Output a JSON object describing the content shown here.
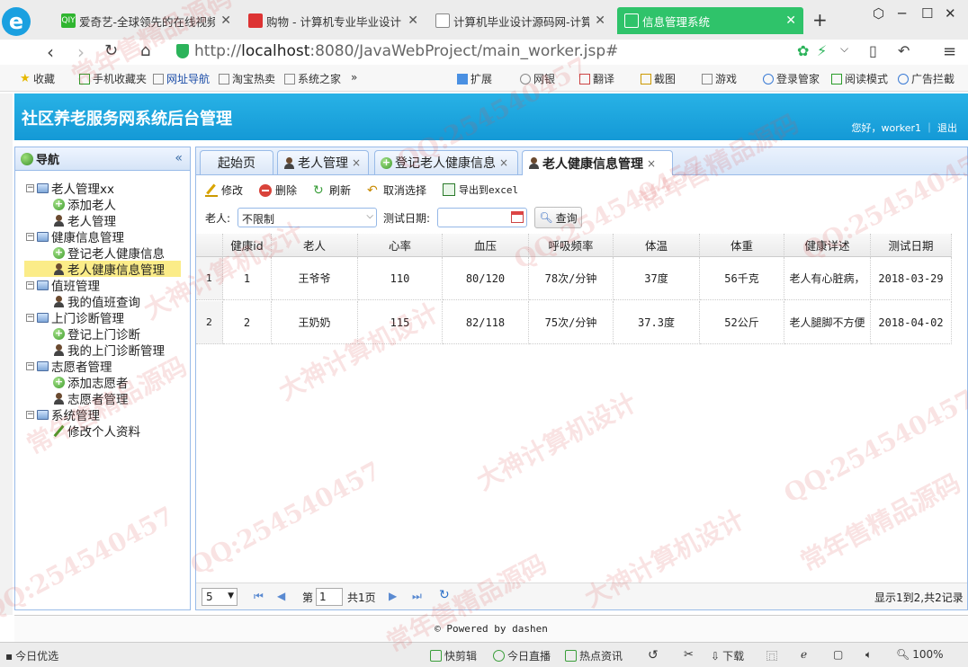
{
  "browser": {
    "tabs": [
      {
        "label": "爱奇艺-全球领先的在线视频",
        "fav": "QIY",
        "fav_color": "#2fb52f"
      },
      {
        "label": "购物 - 计算机专业毕业设计",
        "fav": "",
        "fav_color": "#d33"
      },
      {
        "label": "计算机毕业设计源码网-计算",
        "fav": "",
        "fav_color": "#ffffff"
      },
      {
        "label": "信息管理系统",
        "fav": "",
        "fav_color": "#ffffff"
      }
    ],
    "new_tab": "+",
    "url_prefix": "http://",
    "url_host": "localhost",
    "url_rest": ":8080/JavaWebProject/main_worker.jsp#",
    "bookmarks": [
      "收藏",
      "手机收藏夹",
      "网址导航",
      "淘宝热卖",
      "系统之家",
      "扩展",
      "网银",
      "翻译",
      "截图",
      "游戏",
      "登录管家",
      "阅读模式",
      "广告拦截"
    ],
    "bookmarks_more": "»"
  },
  "app": {
    "title": "社区养老服务网系统后台管理",
    "user_greeting": "您好，worker1 ｜ 退出",
    "footer": "© Powered by dashen"
  },
  "nav": {
    "title": "导航",
    "collapse": "«",
    "items": [
      {
        "label": "老人管理xx",
        "level": 0
      },
      {
        "label": "添加老人",
        "level": 1,
        "icon": "add"
      },
      {
        "label": "老人管理",
        "level": 1,
        "icon": "user"
      },
      {
        "label": "健康信息管理",
        "level": 0
      },
      {
        "label": "登记老人健康信息",
        "level": 1,
        "icon": "add"
      },
      {
        "label": "老人健康信息管理",
        "level": 1,
        "icon": "user",
        "selected": true
      },
      {
        "label": "值班管理",
        "level": 0
      },
      {
        "label": "我的值班查询",
        "level": 1,
        "icon": "user"
      },
      {
        "label": "上门诊断管理",
        "level": 0
      },
      {
        "label": "登记上门诊断",
        "level": 1,
        "icon": "add"
      },
      {
        "label": "我的上门诊断管理",
        "level": 1,
        "icon": "user"
      },
      {
        "label": "志愿者管理",
        "level": 0
      },
      {
        "label": "添加志愿者",
        "level": 1,
        "icon": "add"
      },
      {
        "label": "志愿者管理",
        "level": 1,
        "icon": "user"
      },
      {
        "label": "系统管理",
        "level": 0
      },
      {
        "label": "修改个人资料",
        "level": 1,
        "icon": "pencil"
      }
    ]
  },
  "tabs": [
    {
      "label": "起始页",
      "closable": false
    },
    {
      "label": "老人管理",
      "closable": true
    },
    {
      "label": "登记老人健康信息",
      "closable": true
    },
    {
      "label": "老人健康信息管理",
      "closable": true,
      "active": true
    }
  ],
  "toolbar": {
    "edit": "修改",
    "delete": "删除",
    "refresh": "刷新",
    "cancel_select": "取消选择",
    "export": "导出到excel"
  },
  "filter": {
    "elder_label": "老人:",
    "elder_value": "不限制",
    "date_label": "测试日期:",
    "date_value": "",
    "query": "查询"
  },
  "grid": {
    "columns": [
      "健康id",
      "老人",
      "心率",
      "血压",
      "呼吸频率",
      "体温",
      "体重",
      "健康详述",
      "测试日期"
    ],
    "rows": [
      [
        "1",
        "王爷爷",
        "110",
        "80/120",
        "78次/分钟",
        "37度",
        "56千克",
        "老人有心脏病，",
        "2018-03-29"
      ],
      [
        "2",
        "王奶奶",
        "115",
        "82/118",
        "75次/分钟",
        "37.3度",
        "52公斤",
        "老人腿脚不方便",
        "2018-04-02"
      ]
    ],
    "row_numbers": [
      "1",
      "2"
    ]
  },
  "pager": {
    "page_size": "5",
    "page_prefix": "第",
    "page_value": "1",
    "page_suffix": "共1页",
    "summary": "显示1到2,共2记录"
  },
  "statusbar": {
    "left": "今日优选",
    "items": [
      "快剪辑",
      "今日直播",
      "热点资讯",
      "下载",
      "100%"
    ]
  },
  "watermarks": [
    "常年售精品源码",
    "QQ:254540457",
    "大神计算机设计"
  ],
  "colors": {
    "header": "#1ea6de",
    "active_tab": "#2fc36a",
    "selected": "#fbec88",
    "border": "#99bbe8"
  }
}
